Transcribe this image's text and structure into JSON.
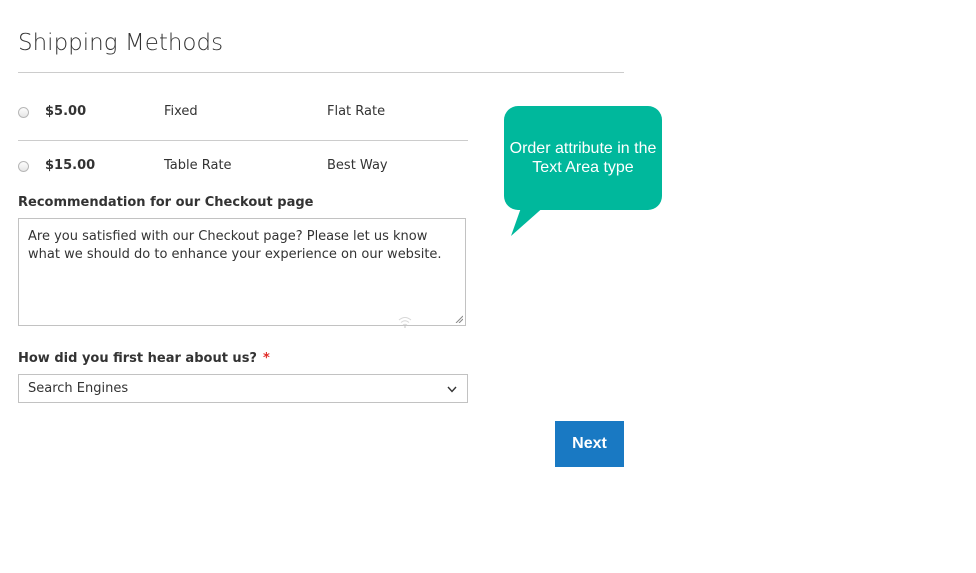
{
  "page": {
    "title": "Shipping Methods"
  },
  "shipping_methods": [
    {
      "price": "$5.00",
      "method": "Fixed",
      "carrier": "Flat Rate",
      "selected": false
    },
    {
      "price": "$15.00",
      "method": "Table Rate",
      "carrier": "Best Way",
      "selected": false
    }
  ],
  "recommendation": {
    "label": "Recommendation for our Checkout page",
    "value": "Are you satisfied with our Checkout page? Please let us know what we should do to enhance your experience on our website."
  },
  "hear_about": {
    "label": "How did you first hear about us?",
    "required_marker": "*",
    "selected_value": "Search Engines"
  },
  "actions": {
    "next_label": "Next"
  },
  "callout": {
    "text": "Order attribute in the Text Area type"
  },
  "icons": {
    "radio": "radio-icon",
    "resize": "resize-handle-icon",
    "wifi": "wifi-icon",
    "dropdown": "chevron-down-icon"
  },
  "colors": {
    "primary_button": "#1979c3",
    "callout_bg": "#00b89c",
    "required": "#e02b27"
  }
}
